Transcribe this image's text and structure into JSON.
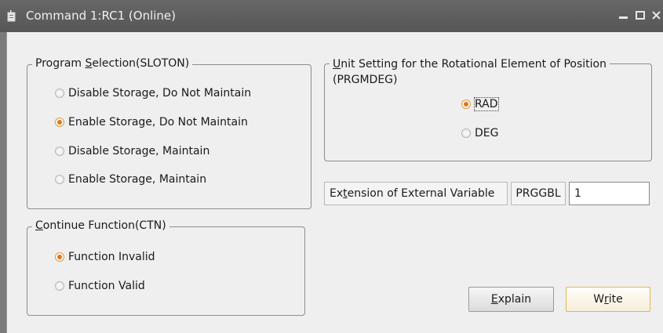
{
  "window": {
    "title": "Command 1:RC1 (Online)"
  },
  "program_selection": {
    "legend_pre": "Program ",
    "legend_key": "S",
    "legend_post": "election(SLOTON)",
    "options": [
      {
        "label": "Disable Storage, Do Not Maintain",
        "selected": false
      },
      {
        "label": "Enable Storage, Do Not Maintain",
        "selected": true
      },
      {
        "label": "Disable Storage, Maintain",
        "selected": false
      },
      {
        "label": "Enable Storage, Maintain",
        "selected": false
      }
    ]
  },
  "continue_function": {
    "legend_pre": "",
    "legend_key": "C",
    "legend_post": "ontinue Function(CTN)",
    "options": [
      {
        "label": "Function Invalid",
        "selected": true
      },
      {
        "label": "Function Valid",
        "selected": false
      }
    ]
  },
  "unit_setting": {
    "legend_line1_key": "U",
    "legend_line1_post": "nit Setting for the Rotational Element of Position",
    "legend_line2": "(PRGMDEG)",
    "options": [
      {
        "label": "RAD",
        "selected": true
      },
      {
        "label": "DEG",
        "selected": false
      }
    ]
  },
  "extension": {
    "label_pre": "Ex",
    "label_key": "t",
    "label_post": "ension of External Variable",
    "param": "PRGGBL",
    "value": "1"
  },
  "buttons": {
    "explain_key": "E",
    "explain_post": "xplain",
    "write_pre": "W",
    "write_key": "r",
    "write_post": "ite"
  },
  "colors": {
    "titlebar": "#5e5e5e",
    "dialog_bg": "#efefef",
    "radio_selected": "#e0781c",
    "default_button_border": "#e3b64c"
  }
}
